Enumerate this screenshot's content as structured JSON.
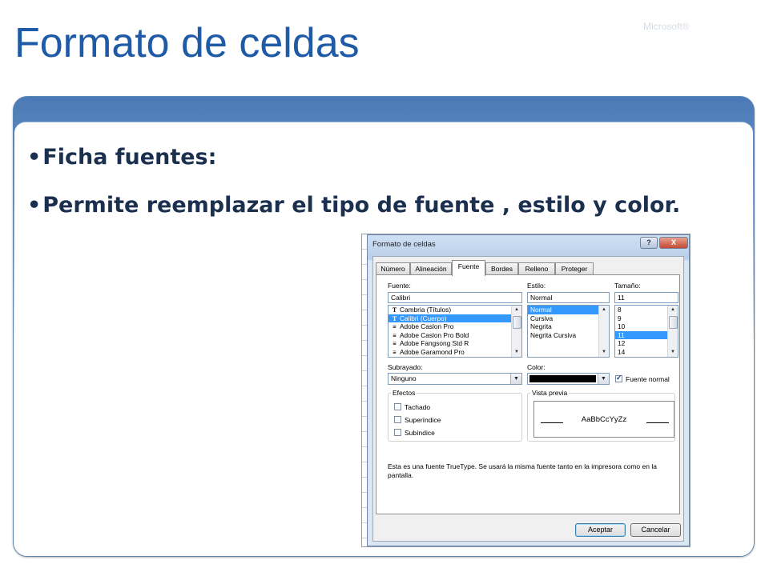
{
  "slide": {
    "title": "Formato de celdas",
    "brand": "Microsoft®",
    "bullets": [
      "Ficha fuentes:",
      "Permite reemplazar el tipo de fuente , estilo y color."
    ],
    "bullet_glyph": "•"
  },
  "dialog": {
    "title": "Formato de celdas",
    "help_label": "?",
    "close_label": "X",
    "tabs": [
      "Número",
      "Alineación",
      "Fuente",
      "Bordes",
      "Relleno",
      "Proteger"
    ],
    "active_tab": "Fuente",
    "font": {
      "label": "Fuente:",
      "value": "Calibri",
      "items": [
        {
          "icon": "T",
          "name": "Cambria (Títulos)"
        },
        {
          "icon": "T",
          "name": "Calibri (Cuerpo)",
          "selected": true
        },
        {
          "icon": "≡",
          "name": "Adobe Caslon Pro"
        },
        {
          "icon": "≡",
          "name": "Adobe Caslon Pro Bold"
        },
        {
          "icon": "≡",
          "name": "Adobe Fangsong Std R"
        },
        {
          "icon": "≡",
          "name": "Adobe Garamond Pro"
        }
      ]
    },
    "style": {
      "label": "Estilo:",
      "value": "Normal",
      "items": [
        {
          "name": "Normal",
          "selected": true
        },
        {
          "name": "Cursiva"
        },
        {
          "name": "Negrita"
        },
        {
          "name": "Negrita Cursiva"
        }
      ]
    },
    "size": {
      "label": "Tamaño:",
      "value": "11",
      "items": [
        {
          "name": "8"
        },
        {
          "name": "9"
        },
        {
          "name": "10"
        },
        {
          "name": "11",
          "selected": true
        },
        {
          "name": "12"
        },
        {
          "name": "14"
        }
      ]
    },
    "underline": {
      "label": "Subrayado:",
      "value": "Ninguno"
    },
    "color": {
      "label": "Color:",
      "value": "#000000"
    },
    "normal_font": {
      "label": "Fuente normal",
      "checked": true
    },
    "effects": {
      "label": "Efectos",
      "items": [
        {
          "label": "Tachado",
          "checked": false
        },
        {
          "label": "Superíndice",
          "checked": false
        },
        {
          "label": "Subíndice",
          "checked": false
        }
      ]
    },
    "preview": {
      "label": "Vista previa",
      "sample": "AaBbCcYyZz"
    },
    "info": "Esta es una fuente TrueType. Se usará la misma fuente tanto en la impresora como en la pantalla.",
    "ok_label": "Aceptar",
    "cancel_label": "Cancelar"
  },
  "colors": {
    "title": "#1f5aa6",
    "text": "#1b2f4e",
    "selection": "#3399ff"
  }
}
